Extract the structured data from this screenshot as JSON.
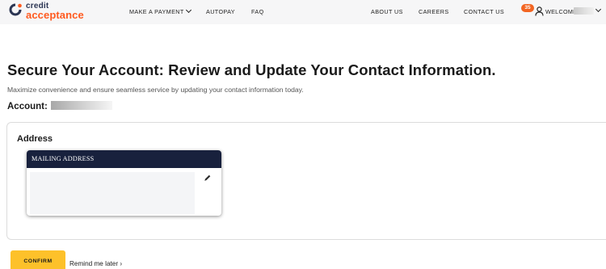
{
  "brand": {
    "logo_top": "credit",
    "logo_bottom": "acceptance",
    "colors": {
      "navy": "#18213d",
      "orange": "#ff5a1f",
      "yellow": "#fdc12a"
    }
  },
  "nav": {
    "make_payment": "MAKE A PAYMENT",
    "autopay": "AUTOPAY",
    "faq": "FAQ",
    "about_us": "ABOUT US",
    "careers": "CAREERS",
    "contact_us": "CONTACT US",
    "badge_count": "35",
    "welcome": "WELCOME"
  },
  "main": {
    "title": "Secure Your Account: Review and Update Your Contact Information.",
    "subtitle": "Maximize convenience and ensure seamless service by updating your contact information today.",
    "account_label": "Account:"
  },
  "address": {
    "section_title": "Address",
    "card_header": "MAILING ADDRESS",
    "icons": {
      "edit": "pencil-icon"
    }
  },
  "actions": {
    "confirm": "CONFIRM",
    "remind_later": "Remind me later ›"
  }
}
